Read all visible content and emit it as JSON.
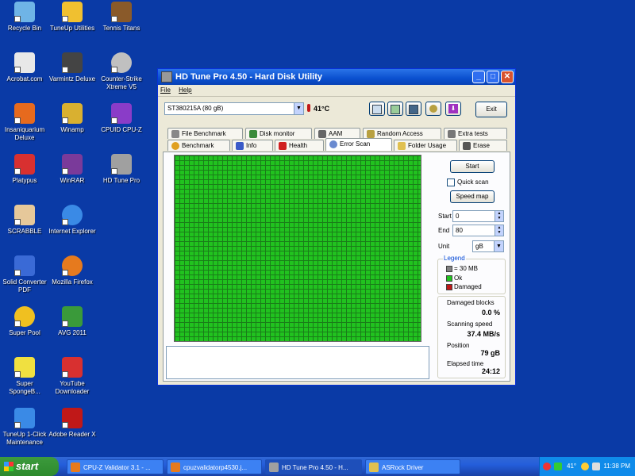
{
  "desktop": {
    "icons": [
      {
        "label": "Recycle Bin",
        "color": "#6fb4e6"
      },
      {
        "label": "TuneUp Utilities",
        "color": "#f0c030"
      },
      {
        "label": "Tennis Titans",
        "color": "#8a5a2a"
      },
      {
        "label": "Acrobat.com",
        "color": "#e8e8e8"
      },
      {
        "label": "Varmintz Deluxe",
        "color": "#444444"
      },
      {
        "label": "Counter-Strike Xtreme V5",
        "color": "#c0c0c0"
      },
      {
        "label": "Insaniquarium Deluxe",
        "color": "#e66a1e"
      },
      {
        "label": "Winamp",
        "color": "#d9b030"
      },
      {
        "label": "CPUID CPU-Z",
        "color": "#8a3cc8"
      },
      {
        "label": "Platypus",
        "color": "#d83030"
      },
      {
        "label": "WinRAR",
        "color": "#7a3a9a"
      },
      {
        "label": "HD Tune Pro",
        "color": "#a0a0a0"
      },
      {
        "label": "SCRABBLE",
        "color": "#e6c89a"
      },
      {
        "label": "Internet Explorer",
        "color": "#3a8ae6"
      },
      {
        "label": "Solid Converter PDF",
        "color": "#3a6ad6"
      },
      {
        "label": "Mozilla Firefox",
        "color": "#e67a1e"
      },
      {
        "label": "Super Pool",
        "color": "#f0c020"
      },
      {
        "label": "AVG 2011",
        "color": "#3a9a3a"
      },
      {
        "label": "Super SpongeB...",
        "color": "#f0e040"
      },
      {
        "label": "YouTube Downloader",
        "color": "#d83030"
      },
      {
        "label": "TuneUp 1-Click Maintenance",
        "color": "#3a8ae6"
      },
      {
        "label": "Adobe Reader X",
        "color": "#c01818"
      }
    ]
  },
  "window": {
    "title": "HD Tune Pro 4.50 - Hard Disk Utility",
    "menu": [
      "File",
      "Help"
    ],
    "drive": "ST380215A (80 gB)",
    "temperature": "41°C",
    "exit_label": "Exit",
    "tabs_top": [
      "File Benchmark",
      "Disk monitor",
      "AAM",
      "Random Access",
      "Extra tests"
    ],
    "tabs_bottom": [
      "Benchmark",
      "Info",
      "Health",
      "Error Scan",
      "Folder Usage",
      "Erase"
    ],
    "active_tab": "Error Scan",
    "controls": {
      "start_label": "Start",
      "quick_scan_label": "Quick scan",
      "speed_map_label": "Speed map",
      "start_field_label": "Start",
      "start_value": "0",
      "end_field_label": "End",
      "end_value": "80",
      "unit_label": "Unit",
      "unit_value": "gB"
    },
    "legend": {
      "title": "Legend",
      "items": [
        {
          "label": "= 30 MB",
          "color": "#808080"
        },
        {
          "label": "Ok",
          "color": "#21c21f"
        },
        {
          "label": "Damaged",
          "color": "#c01818"
        }
      ]
    },
    "stats": {
      "damaged_label": "Damaged blocks",
      "damaged_value": "0.0 %",
      "speed_label": "Scanning speed",
      "speed_value": "37.4 MB/s",
      "position_label": "Position",
      "position_value": "79 gB",
      "elapsed_label": "Elapsed time",
      "elapsed_value": "24:12"
    }
  },
  "taskbar": {
    "start_label": "start",
    "tasks": [
      {
        "label": "CPU-Z Validator 3.1 - ..."
      },
      {
        "label": "cpuzvalidatorp4530.j..."
      },
      {
        "label": "HD Tune Pro 4.50 - H..."
      },
      {
        "label": "ASRock Driver"
      }
    ],
    "tray_temp": "41°",
    "clock": "11:38 PM"
  },
  "colors": {
    "desktop": "#0a3aa6",
    "ok_block": "#21c21f",
    "titlebar": "#0a4fcf"
  }
}
